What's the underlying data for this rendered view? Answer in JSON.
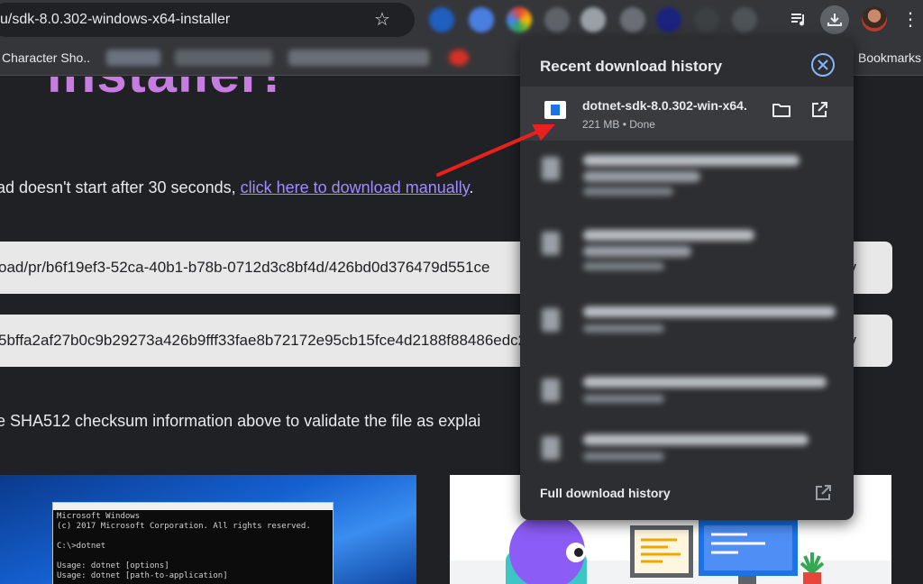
{
  "toolbar": {
    "url": "u/sdk-8.0.302-windows-x64-installer",
    "icons": [
      "star-icon",
      "media-queue-icon",
      "download-icon",
      "more-vert-icon"
    ]
  },
  "bookmarks": {
    "first": "Character Sho..",
    "last": "Bookmarks"
  },
  "page": {
    "hero_title": "installer!",
    "line1_prefix": "ad doesn't start after 30 seconds, ",
    "line1_link": "click here to download manually",
    "line1_suffix": ".",
    "field1_value": "oad/pr/b6f19ef3-52ca-40b1-b78b-0712d3c8bf4d/426bd0d376479d551ce",
    "field2_value": "5bffa2af27b0c9b29273a426b9fff33fae8b72172e95cb15fce4d2188f88486edc2",
    "copy_label": "py",
    "line2": "e SHA512 checksum information above to validate the file as explai",
    "cmd_lines": "Microsoft Windows\n(c) 2017 Microsoft Corporation. All rights reserved.\n\nC:\\>dotnet\n\nUsage: dotnet [options]\nUsage: dotnet [path-to-application]"
  },
  "downloads": {
    "title": "Recent download history",
    "item": {
      "name": "dotnet-sdk-8.0.302-win-x64.",
      "size": "221 MB",
      "separator": " • ",
      "status": "Done"
    },
    "full_history": "Full download history"
  },
  "colors": {
    "accent": "#8ab4f8",
    "annotation_arrow": "#e8201e",
    "link": "#a08cff",
    "hero": "#c77de0"
  }
}
